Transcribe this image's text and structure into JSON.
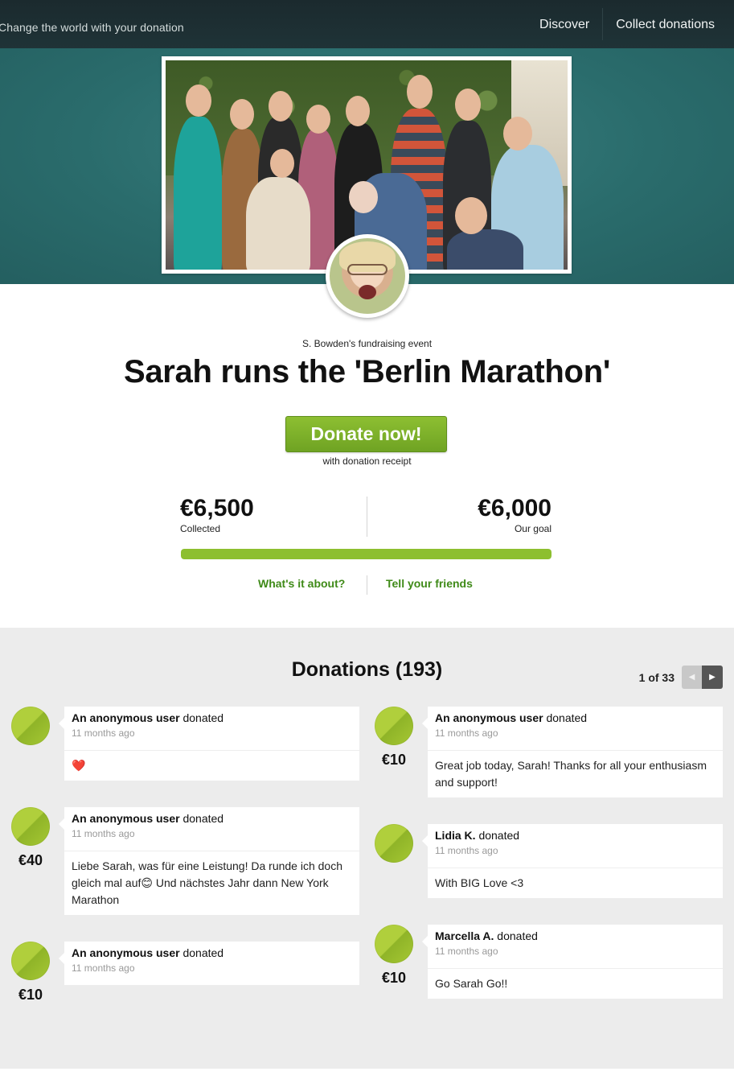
{
  "header": {
    "tagline": "Change the world with your donation",
    "nav": [
      "Discover",
      "Collect donations"
    ]
  },
  "event": {
    "organizer_line": "S. Bowden's fundraising event",
    "title": "Sarah runs the 'Berlin Marathon'",
    "donate_label": "Donate now!",
    "receipt_note": "with donation receipt",
    "collected_amount": "€6,500",
    "collected_label": "Collected",
    "goal_amount": "€6,000",
    "goal_label": "Our goal",
    "progress_fraction": 1.0,
    "about_link": "What's it about?",
    "tell_link": "Tell your friends"
  },
  "donations": {
    "title": "Donations (193)",
    "pager_text": "1 of 33",
    "items": [
      {
        "name": "An anonymous user",
        "verb": "donated",
        "time": "11 months ago",
        "amount": "",
        "message": "❤️"
      },
      {
        "name": "An anonymous user",
        "verb": "donated",
        "time": "11 months ago",
        "amount": "€40",
        "message": "Liebe Sarah, was für eine Leistung! Da runde ich doch gleich mal auf😊  Und nächstes Jahr dann New York Marathon"
      },
      {
        "name": "An anonymous user",
        "verb": "donated",
        "time": "11 months ago",
        "amount": "€10",
        "message": ""
      },
      {
        "name": "An anonymous user",
        "verb": "donated",
        "time": "11 months ago",
        "amount": "€10",
        "message": "Great job today, Sarah! Thanks for all your enthusiasm and support!"
      },
      {
        "name": "Lidia K.",
        "verb": "donated",
        "time": "11 months ago",
        "amount": "",
        "message": "With BIG Love <3"
      },
      {
        "name": "Marcella A.",
        "verb": "donated",
        "time": "11 months ago",
        "amount": "€10",
        "message": "Go Sarah Go!!"
      }
    ]
  },
  "colors": {
    "nav_bg": "#1d2f33",
    "hero_bg": "#2d6f70",
    "accent_green": "#7ab22a",
    "link_green": "#3f8a18",
    "donations_bg": "#ececec"
  }
}
